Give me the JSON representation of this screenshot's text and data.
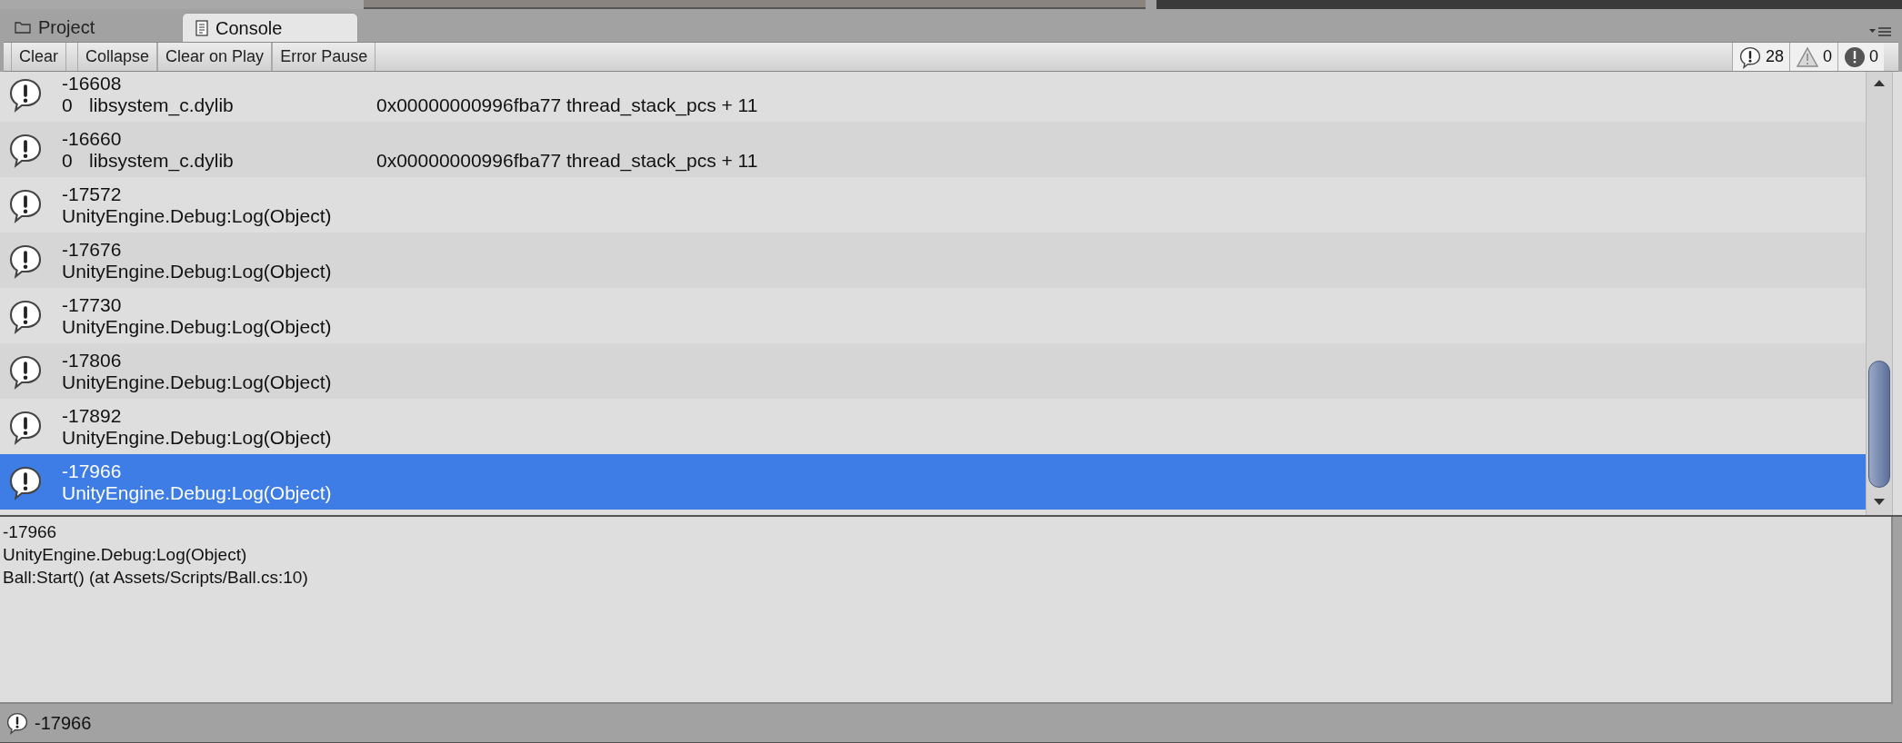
{
  "tabs": [
    {
      "label": "Project",
      "kind": "folder",
      "selected": false
    },
    {
      "label": "Console",
      "kind": "document",
      "selected": true
    }
  ],
  "toolbar": {
    "buttons": [
      {
        "label": "Clear"
      },
      {
        "label": "Collapse"
      },
      {
        "label": "Clear on Play"
      },
      {
        "label": "Error Pause"
      }
    ],
    "counters": [
      {
        "kind": "info",
        "count": "28"
      },
      {
        "kind": "warning",
        "count": "0"
      },
      {
        "kind": "error",
        "count": "0"
      }
    ]
  },
  "log": [
    {
      "kind": "stack",
      "line_1": "-16608",
      "columns": [
        "0",
        "libsystem_c.dylib",
        "0x00000000996fba77 thread_stack_pcs + 11"
      ],
      "selected": false
    },
    {
      "kind": "stack",
      "line_1": "-16660",
      "columns": [
        "0",
        "libsystem_c.dylib",
        "0x00000000996fba77 thread_stack_pcs + 11"
      ],
      "selected": false
    },
    {
      "kind": "message",
      "line_1": "-17572",
      "line_2": "UnityEngine.Debug:Log(Object)",
      "selected": false
    },
    {
      "kind": "message",
      "line_1": "-17676",
      "line_2": "UnityEngine.Debug:Log(Object)",
      "selected": false
    },
    {
      "kind": "message",
      "line_1": "-17730",
      "line_2": "UnityEngine.Debug:Log(Object)",
      "selected": false
    },
    {
      "kind": "message",
      "line_1": "-17806",
      "line_2": "UnityEngine.Debug:Log(Object)",
      "selected": false
    },
    {
      "kind": "message",
      "line_1": "-17892",
      "line_2": "UnityEngine.Debug:Log(Object)",
      "selected": false
    },
    {
      "kind": "message",
      "line_1": "-17966",
      "line_2": "UnityEngine.Debug:Log(Object)",
      "selected": true
    }
  ],
  "detail": [
    "-17966",
    "UnityEngine.Debug:Log(Object)",
    "Ball:Start() (at Assets/Scripts/Ball.cs:10)"
  ],
  "status_bar": {
    "text": "-17966"
  }
}
